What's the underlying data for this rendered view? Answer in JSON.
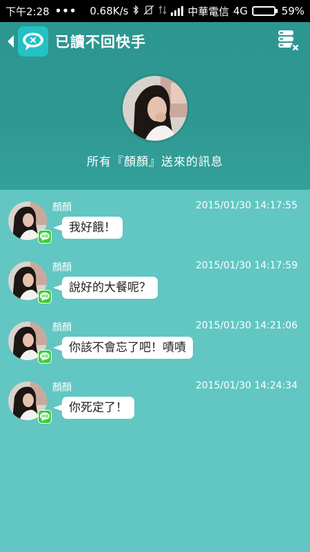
{
  "status_bar": {
    "time": "下午2:28",
    "dots": "•••",
    "speed": "0.68K/s",
    "carrier": "中華電信",
    "network": "4G",
    "battery_percent": "59%",
    "battery_level": 0.59,
    "battery_color": "#35d12a",
    "icons": [
      "bluetooth-icon",
      "vibrate-off-icon",
      "data-arrows-icon",
      "signal-icon",
      "battery-icon"
    ]
  },
  "app_bar": {
    "title": "已讀不回快手",
    "logo_icon": "speech-bubble-x-icon",
    "action_icon": "clear-database-icon"
  },
  "profile": {
    "caption": "所有『顏顏』送來的訊息"
  },
  "messages": [
    {
      "sender": "顏顏",
      "time": "2015/01/30 14:17:55",
      "text": "我好餓！",
      "app": "LINE"
    },
    {
      "sender": "顏顏",
      "time": "2015/01/30 14:17:59",
      "text": "說好的大餐呢？",
      "app": "LINE"
    },
    {
      "sender": "顏顏",
      "time": "2015/01/30 14:21:06",
      "text": "你該不會忘了吧！嘖嘖",
      "app": "LINE"
    },
    {
      "sender": "顏顏",
      "time": "2015/01/30 14:24:34",
      "text": "你死定了！",
      "app": "LINE"
    }
  ],
  "colors": {
    "header": "#2f9791",
    "background": "#62c6c3",
    "logo": "#25c1c3",
    "line_badge": "#3acf3a"
  }
}
